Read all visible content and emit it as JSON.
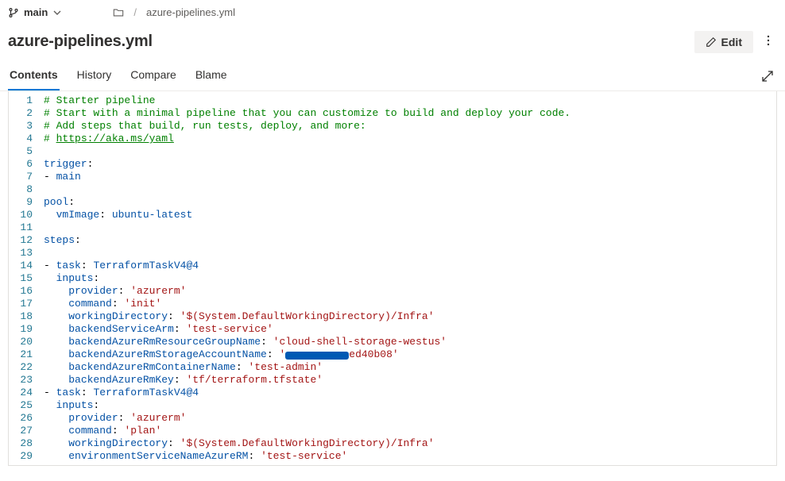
{
  "breadcrumb": {
    "branch_name": "main",
    "path_item": "azure-pipelines.yml"
  },
  "header": {
    "file_title": "azure-pipelines.yml",
    "edit_label": "Edit"
  },
  "tabs": {
    "contents": "Contents",
    "history": "History",
    "compare": "Compare",
    "blame": "Blame"
  },
  "code": {
    "lines": [
      {
        "n": 1,
        "segs": [
          {
            "c": "tok-comment",
            "t": "# Starter pipeline"
          }
        ]
      },
      {
        "n": 2,
        "segs": [
          {
            "c": "tok-comment",
            "t": "# Start with a minimal pipeline that you can customize to build and deploy your code."
          }
        ]
      },
      {
        "n": 3,
        "segs": [
          {
            "c": "tok-comment",
            "t": "# Add steps that build, run tests, deploy, and more:"
          }
        ]
      },
      {
        "n": 4,
        "segs": [
          {
            "c": "tok-comment",
            "t": "# "
          },
          {
            "c": "tok-link",
            "t": "https://aka.ms/yaml"
          }
        ]
      },
      {
        "n": 5,
        "segs": []
      },
      {
        "n": 6,
        "segs": [
          {
            "c": "tok-key",
            "t": "trigger"
          },
          {
            "c": "tok-plain",
            "t": ":"
          }
        ]
      },
      {
        "n": 7,
        "segs": [
          {
            "c": "tok-plain",
            "t": "- "
          },
          {
            "c": "tok-key",
            "t": "main"
          }
        ]
      },
      {
        "n": 8,
        "segs": []
      },
      {
        "n": 9,
        "segs": [
          {
            "c": "tok-key",
            "t": "pool"
          },
          {
            "c": "tok-plain",
            "t": ":"
          }
        ]
      },
      {
        "n": 10,
        "segs": [
          {
            "c": "tok-plain",
            "t": "  "
          },
          {
            "c": "tok-key",
            "t": "vmImage"
          },
          {
            "c": "tok-plain",
            "t": ": "
          },
          {
            "c": "tok-key",
            "t": "ubuntu-latest"
          }
        ]
      },
      {
        "n": 11,
        "segs": []
      },
      {
        "n": 12,
        "segs": [
          {
            "c": "tok-key",
            "t": "steps"
          },
          {
            "c": "tok-plain",
            "t": ":"
          }
        ]
      },
      {
        "n": 13,
        "segs": []
      },
      {
        "n": 14,
        "segs": [
          {
            "c": "tok-plain",
            "t": "- "
          },
          {
            "c": "tok-key",
            "t": "task"
          },
          {
            "c": "tok-plain",
            "t": ": "
          },
          {
            "c": "tok-task",
            "t": "TerraformTaskV4@4"
          }
        ]
      },
      {
        "n": 15,
        "segs": [
          {
            "c": "tok-plain",
            "t": "  "
          },
          {
            "c": "tok-key",
            "t": "inputs"
          },
          {
            "c": "tok-plain",
            "t": ":"
          }
        ]
      },
      {
        "n": 16,
        "segs": [
          {
            "c": "tok-plain",
            "t": "    "
          },
          {
            "c": "tok-key",
            "t": "provider"
          },
          {
            "c": "tok-plain",
            "t": ": "
          },
          {
            "c": "tok-str",
            "t": "'azurerm'"
          }
        ]
      },
      {
        "n": 17,
        "segs": [
          {
            "c": "tok-plain",
            "t": "    "
          },
          {
            "c": "tok-key",
            "t": "command"
          },
          {
            "c": "tok-plain",
            "t": ": "
          },
          {
            "c": "tok-str",
            "t": "'init'"
          }
        ]
      },
      {
        "n": 18,
        "segs": [
          {
            "c": "tok-plain",
            "t": "    "
          },
          {
            "c": "tok-key",
            "t": "workingDirectory"
          },
          {
            "c": "tok-plain",
            "t": ": "
          },
          {
            "c": "tok-str",
            "t": "'$(System.DefaultWorkingDirectory)/Infra'"
          }
        ]
      },
      {
        "n": 19,
        "segs": [
          {
            "c": "tok-plain",
            "t": "    "
          },
          {
            "c": "tok-key",
            "t": "backendServiceArm"
          },
          {
            "c": "tok-plain",
            "t": ": "
          },
          {
            "c": "tok-str",
            "t": "'test-service'"
          }
        ]
      },
      {
        "n": 20,
        "segs": [
          {
            "c": "tok-plain",
            "t": "    "
          },
          {
            "c": "tok-key",
            "t": "backendAzureRmResourceGroupName"
          },
          {
            "c": "tok-plain",
            "t": ": "
          },
          {
            "c": "tok-str",
            "t": "'cloud-shell-storage-westus'"
          }
        ]
      },
      {
        "n": 21,
        "segs": [
          {
            "c": "tok-plain",
            "t": "    "
          },
          {
            "c": "tok-key",
            "t": "backendAzureRmStorageAccountName"
          },
          {
            "c": "tok-plain",
            "t": ": "
          },
          {
            "c": "tok-str",
            "t": "'"
          },
          {
            "c": "redacted",
            "t": "            "
          },
          {
            "c": "tok-str",
            "t": "ed40b08'"
          }
        ]
      },
      {
        "n": 22,
        "segs": [
          {
            "c": "tok-plain",
            "t": "    "
          },
          {
            "c": "tok-key",
            "t": "backendAzureRmContainerName"
          },
          {
            "c": "tok-plain",
            "t": ": "
          },
          {
            "c": "tok-str",
            "t": "'test-admin'"
          }
        ]
      },
      {
        "n": 23,
        "segs": [
          {
            "c": "tok-plain",
            "t": "    "
          },
          {
            "c": "tok-key",
            "t": "backendAzureRmKey"
          },
          {
            "c": "tok-plain",
            "t": ": "
          },
          {
            "c": "tok-str",
            "t": "'tf/terraform.tfstate'"
          }
        ]
      },
      {
        "n": 24,
        "segs": [
          {
            "c": "tok-plain",
            "t": "- "
          },
          {
            "c": "tok-key",
            "t": "task"
          },
          {
            "c": "tok-plain",
            "t": ": "
          },
          {
            "c": "tok-task",
            "t": "TerraformTaskV4@4"
          }
        ]
      },
      {
        "n": 25,
        "segs": [
          {
            "c": "tok-plain",
            "t": "  "
          },
          {
            "c": "tok-key",
            "t": "inputs"
          },
          {
            "c": "tok-plain",
            "t": ":"
          }
        ]
      },
      {
        "n": 26,
        "segs": [
          {
            "c": "tok-plain",
            "t": "    "
          },
          {
            "c": "tok-key",
            "t": "provider"
          },
          {
            "c": "tok-plain",
            "t": ": "
          },
          {
            "c": "tok-str",
            "t": "'azurerm'"
          }
        ]
      },
      {
        "n": 27,
        "segs": [
          {
            "c": "tok-plain",
            "t": "    "
          },
          {
            "c": "tok-key",
            "t": "command"
          },
          {
            "c": "tok-plain",
            "t": ": "
          },
          {
            "c": "tok-str",
            "t": "'plan'"
          }
        ]
      },
      {
        "n": 28,
        "segs": [
          {
            "c": "tok-plain",
            "t": "    "
          },
          {
            "c": "tok-key",
            "t": "workingDirectory"
          },
          {
            "c": "tok-plain",
            "t": ": "
          },
          {
            "c": "tok-str",
            "t": "'$(System.DefaultWorkingDirectory)/Infra'"
          }
        ]
      },
      {
        "n": 29,
        "segs": [
          {
            "c": "tok-plain",
            "t": "    "
          },
          {
            "c": "tok-key",
            "t": "environmentServiceNameAzureRM"
          },
          {
            "c": "tok-plain",
            "t": ": "
          },
          {
            "c": "tok-str",
            "t": "'test-service'"
          }
        ]
      }
    ]
  }
}
